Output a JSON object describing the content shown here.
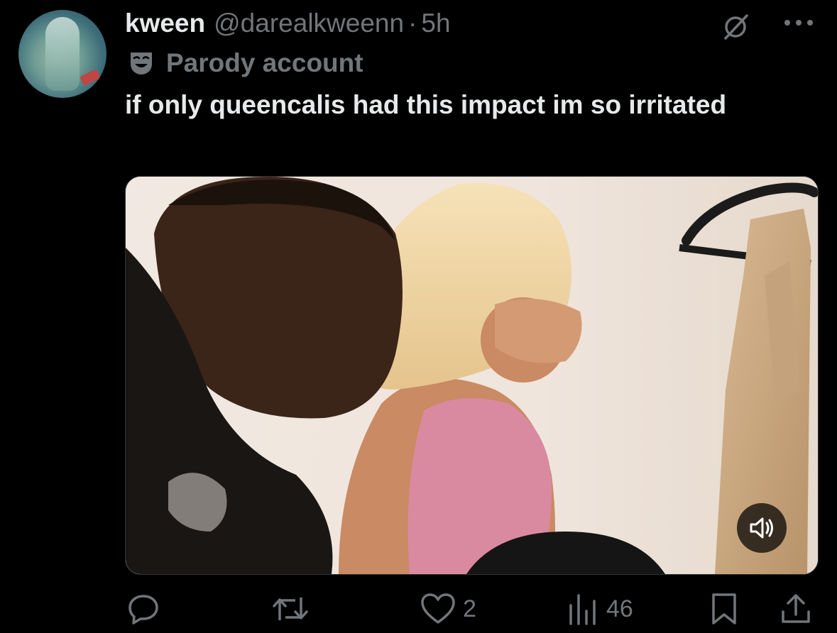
{
  "tweet": {
    "author": {
      "display_name": "kween",
      "handle": "@darealkweenn",
      "separator": "·",
      "time": "5h",
      "label": "Parody account"
    },
    "text": "if only queencalis had this impact im so irritated"
  },
  "icons": {
    "grok": "grok-icon",
    "more": "more-options-icon",
    "parody": "parody-mask-icon",
    "mute": "speaker-icon"
  },
  "actions": {
    "replies": "",
    "reposts": "",
    "likes": "2",
    "views": "46"
  },
  "colors": {
    "background": "#000000",
    "text_primary": "#e7e9ea",
    "text_secondary": "#71767b"
  }
}
